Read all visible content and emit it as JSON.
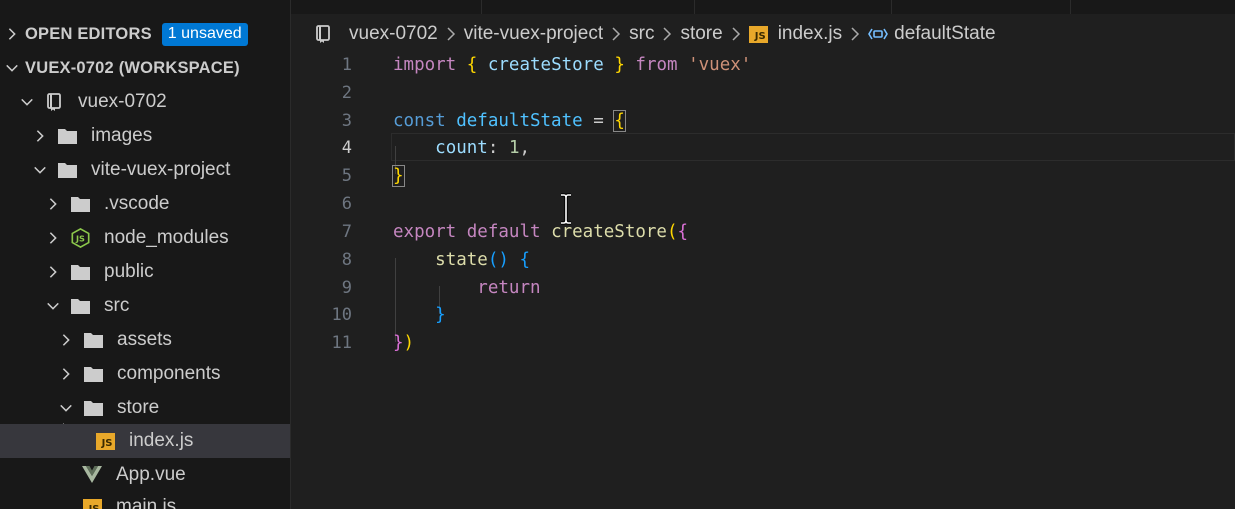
{
  "explorer": {
    "open_editors_label": "OPEN EDITORS",
    "unsaved_badge": "1 unsaved",
    "workspace_label": "VUEX-0702 (WORKSPACE)",
    "items": [
      {
        "label": "vuex-0702",
        "icon": "repo-icon",
        "expanded": true
      },
      {
        "label": "images",
        "icon": "folder-icon",
        "expanded": false
      },
      {
        "label": "vite-vuex-project",
        "icon": "folder-icon",
        "expanded": true
      },
      {
        "label": ".vscode",
        "icon": "folder-icon",
        "expanded": false
      },
      {
        "label": "node_modules",
        "icon": "nodejs-folder-icon",
        "expanded": false
      },
      {
        "label": "public",
        "icon": "folder-icon",
        "expanded": false
      },
      {
        "label": "src",
        "icon": "folder-icon",
        "expanded": true
      },
      {
        "label": "assets",
        "icon": "folder-icon",
        "expanded": false
      },
      {
        "label": "components",
        "icon": "folder-icon",
        "expanded": false
      },
      {
        "label": "store",
        "icon": "folder-icon",
        "expanded": true
      },
      {
        "label": "index.js",
        "icon": "js-file-icon",
        "selected": true
      },
      {
        "label": "App.vue",
        "icon": "vue-file-icon"
      },
      {
        "label": "main.js",
        "icon": "js-file-icon"
      }
    ]
  },
  "breadcrumb": {
    "items": [
      "vuex-0702",
      "vite-vuex-project",
      "src",
      "store",
      "index.js",
      "defaultState"
    ],
    "js_icon_text": "JS"
  },
  "editor": {
    "active_line": 4,
    "line_numbers": [
      "1",
      "2",
      "3",
      "4",
      "5",
      "6",
      "7",
      "8",
      "9",
      "10",
      "11"
    ],
    "code": {
      "l1": {
        "import": "import",
        "ob": "{",
        "createStore": "createStore",
        "cb": "}",
        "from": "from",
        "module": "'vuex'"
      },
      "l3": {
        "const": "const",
        "name": "defaultState",
        "eq": "=",
        "ob": "{"
      },
      "l4": {
        "key": "count",
        "colon": ":",
        "value": "1",
        "comma": ","
      },
      "l5": {
        "cb": "}"
      },
      "l7": {
        "export": "export",
        "default": "default",
        "fn": "createStore",
        "op": "(",
        "ob": "{"
      },
      "l8": {
        "fn": "state",
        "parens": "()",
        "ob": "{"
      },
      "l9": {
        "return": "return"
      },
      "l10": {
        "cb": "}"
      },
      "l11": {
        "cb": "}",
        "cp": ")"
      }
    }
  },
  "colors": {
    "accent_badge": "#0078d4",
    "keyword": "#569cd6",
    "control_keyword": "#c586c0",
    "variable": "#9cdcfe",
    "constant": "#4fc1ff",
    "function": "#dcdcaa",
    "string": "#ce9178",
    "number": "#b5cea8",
    "bracket_level1": "#ffd700",
    "bracket_level2": "#da70d6",
    "bracket_level3": "#179fff"
  }
}
